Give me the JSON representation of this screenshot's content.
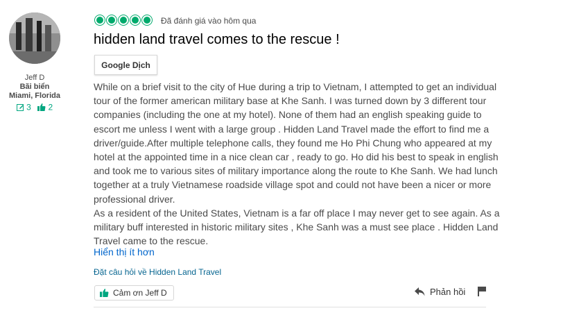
{
  "reviewer": {
    "username": "Jeff D",
    "hometown_line1": "Bãi biển",
    "hometown_line2": "Miami, Florida",
    "review_count": "3",
    "helpful_votes": "2"
  },
  "review": {
    "rating": 5,
    "rating_max": 5,
    "rated_date": "Đã đánh giá vào hôm qua",
    "title": "hidden land travel comes to the rescue !",
    "translate_button": "Google Dịch",
    "paragraph_1": "While on a brief visit to the city of Hue during a trip to Vietnam, I attempted to get an individual tour of the former american military base at Khe Sanh. I was turned down by 3 different tour companies (including the one at my hotel). None of them had an english speaking guide to escort me unless I went with a large group . Hidden Land Travel made the effort to find me a driver/guide.After multiple telephone calls, they found me Ho Phi Chung who appeared at my hotel at the appointed time in a nice clean car , ready to go. Ho did his best to speak in english and took me to various sites of military importance along the route to Khe Sanh. We had lunch together at a truly Vietnamese roadside village spot and could not have been a nicer or more professional driver.",
    "paragraph_2": "As a resident of the United States, Vietnam is a far off place I may never get to see again. As a military buff interested in historic military sites , Khe Sanh was a must see place . Hidden Land Travel came to the rescue.",
    "show_less": "Hiển thị ít hơn",
    "ask_question": "Đặt câu hỏi về Hidden Land Travel"
  },
  "actions": {
    "thank_label": "Cảm ơn Jeff D",
    "reply_label": "Phản hồi"
  },
  "icons": {
    "review_count": "pencil-square-icon",
    "helpful_votes": "thumbs-up-icon",
    "thank": "thumbs-up-icon",
    "reply": "reply-arrow-icon",
    "report": "flag-icon"
  },
  "colors": {
    "bubble_green": "#00aa6c",
    "link_blue": "#0066cc",
    "ask_link": "#066590",
    "stats_green": "#00a680"
  }
}
